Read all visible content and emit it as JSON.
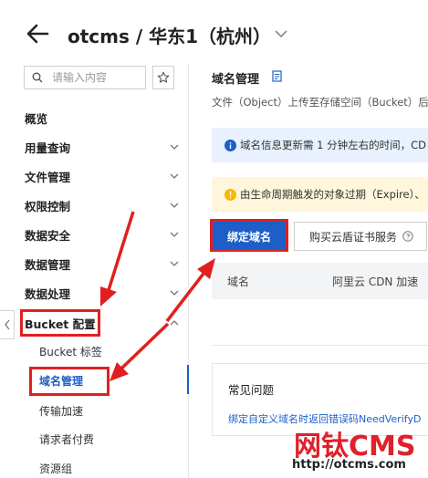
{
  "header": {
    "title": "otcms / 华东1（杭州）"
  },
  "sidebar": {
    "search_placeholder": "请输入内容",
    "items": [
      {
        "label": "概览",
        "has_chevron": false
      },
      {
        "label": "用量查询",
        "has_chevron": true
      },
      {
        "label": "文件管理",
        "has_chevron": true
      },
      {
        "label": "权限控制",
        "has_chevron": true
      },
      {
        "label": "数据安全",
        "has_chevron": true
      },
      {
        "label": "数据管理",
        "has_chevron": true
      },
      {
        "label": "数据处理",
        "has_chevron": true
      },
      {
        "label": "Bucket 配置",
        "expanded": true
      }
    ],
    "sub_items": [
      {
        "label": "Bucket 标签"
      },
      {
        "label": "域名管理",
        "active": true
      },
      {
        "label": "传输加速"
      },
      {
        "label": "请求者付费"
      },
      {
        "label": "资源组"
      }
    ]
  },
  "main": {
    "title": "域名管理",
    "description": "文件（Object）上传至存储空间（Bucket）后",
    "info_alert": "域名信息更新需 1 分钟左右的时间，CD",
    "warn_alert": "由生命周期触发的对象过期（Expire）、",
    "primary_button": "绑定域名",
    "secondary_button": "购买云盾证书服务",
    "table_columns": [
      "域名",
      "阿里云 CDN 加速"
    ],
    "faq_title": "常见问题",
    "faq_link": "绑定自定义域名时返回错误码NeedVerifyD"
  },
  "watermark": {
    "logo": "网钛CMS",
    "url": "http://otcms.com"
  },
  "colors": {
    "primary": "#1d5fc7",
    "highlight": "#e02020",
    "info_bg": "#e8f1fd",
    "warn_bg": "#fff6dc",
    "warn_icon": "#f5b800"
  }
}
